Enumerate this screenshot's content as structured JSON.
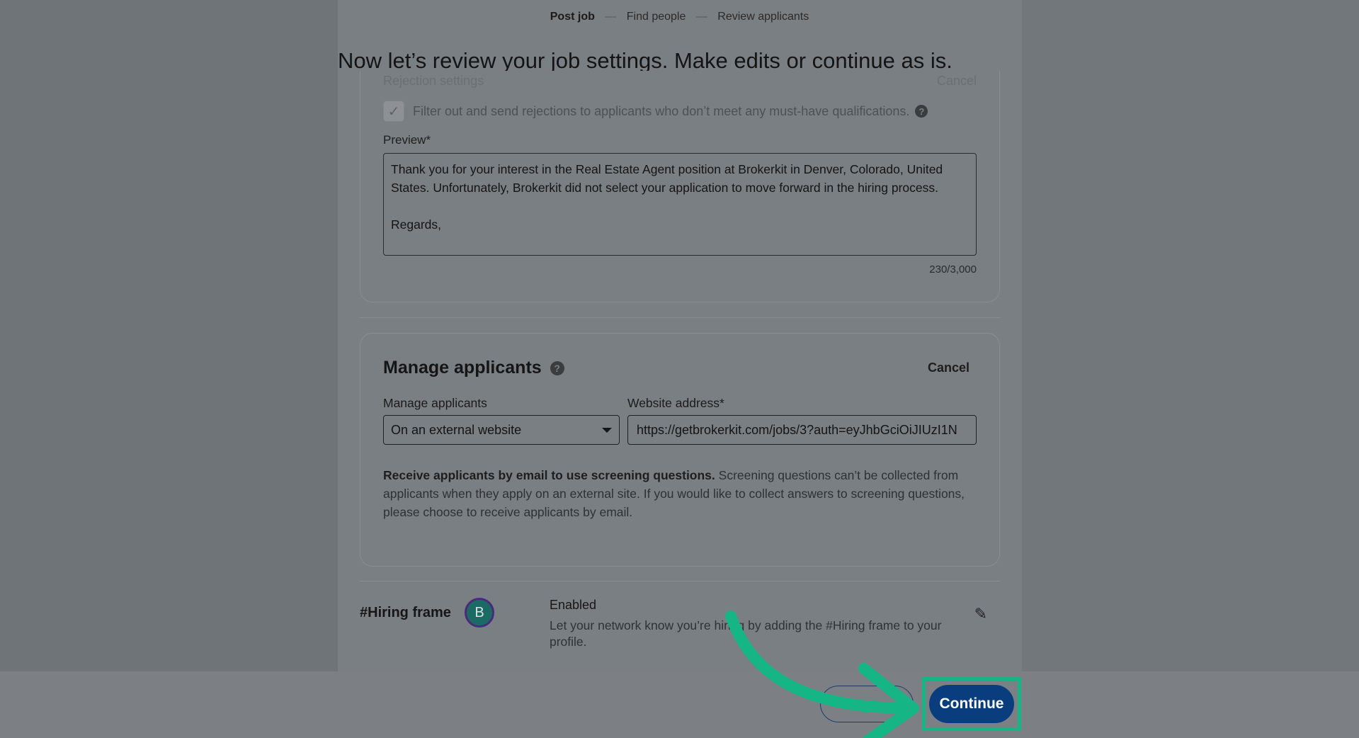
{
  "stepper": {
    "steps": [
      "Post job",
      "Find people",
      "Review applicants"
    ],
    "separator": "—"
  },
  "heading": "Now let’s review your job settings. Make edits or continue as is.",
  "rejection": {
    "title": "Rejection settings",
    "action": "Cancel",
    "checkbox_label": "Filter out and send rejections to applicants who don’t meet any must-have qualifications.",
    "checked": true,
    "preview_label": "Preview*",
    "preview_text_1": "Thank you for your interest in the Real Estate Agent position at Brokerkit in Denver, Colorado, United States. Unfortunately, Brokerkit did not select your application to move forward in the hiring process.",
    "preview_text_2": "Regards,",
    "counter": "230/3,000"
  },
  "manage": {
    "title": "Manage applicants",
    "cancel_label": "Cancel",
    "select_label": "Manage applicants",
    "select_value": "On an external website",
    "url_label": "Website address*",
    "url_value": "https://getbrokerkit.com/jobs/3?auth=eyJhbGciOiJIUzI1N",
    "note_bold": "Receive applicants by email to use screening questions.",
    "note_text": " Screening questions can’t be collected from applicants when they apply on an external site. If you would like to collect answers to screening questions, please choose to receive applicants by email."
  },
  "hiring": {
    "title": "#Hiring frame",
    "avatar_letter": "B",
    "status": "Enabled",
    "description": "Let your network know you’re hiring by adding the #Hiring frame to your profile."
  },
  "footer": {
    "continue_label": "Continue"
  },
  "icons": {
    "help": "help-icon",
    "check": "check-icon",
    "caret": "chevron-down-icon",
    "edit": "pencil-icon"
  },
  "colors": {
    "primary_button": "#0a3d7e",
    "highlight": "#16b585"
  }
}
